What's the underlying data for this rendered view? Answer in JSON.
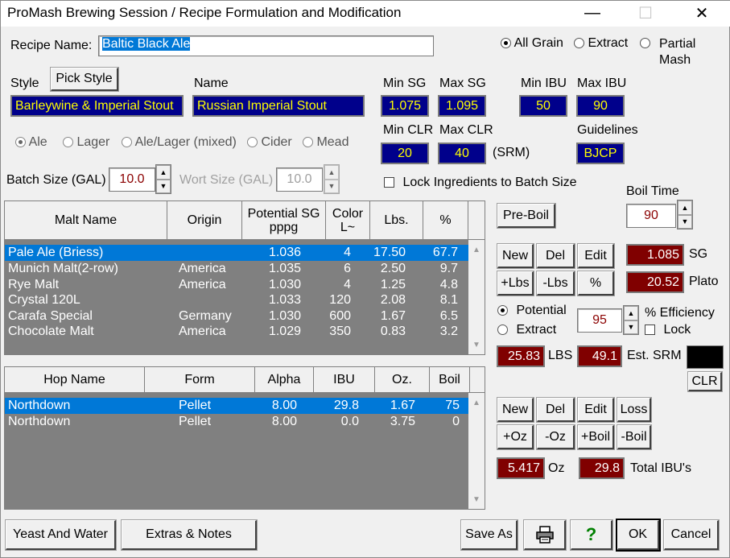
{
  "window": {
    "title": "ProMash Brewing Session / Recipe Formulation and Modification"
  },
  "recipe": {
    "name_label": "Recipe Name:",
    "name": "Baltic Black Ale"
  },
  "recipe_type": {
    "options": [
      "All Grain",
      "Extract",
      "Partial Mash"
    ],
    "selected": "All Grain"
  },
  "style": {
    "label": "Style",
    "pick_label": "Pick Style",
    "category": "Barleywine & Imperial Stout",
    "name_label": "Name",
    "name": "Russian Imperial Stout"
  },
  "guidelines_panel": {
    "min_sg_label": "Min SG",
    "min_sg": "1.075",
    "max_sg_label": "Max SG",
    "max_sg": "1.095",
    "min_ibu_label": "Min IBU",
    "min_ibu": "50",
    "max_ibu_label": "Max IBU",
    "max_ibu": "90",
    "min_clr_label": "Min CLR",
    "min_clr": "20",
    "max_clr_label": "Max CLR",
    "max_clr": "40",
    "srm_label": "(SRM)",
    "guidelines_label": "Guidelines",
    "guidelines": "BJCP"
  },
  "yeast_type": {
    "options": [
      "Ale",
      "Lager",
      "Ale/Lager (mixed)",
      "Cider",
      "Mead"
    ],
    "selected": "Ale"
  },
  "batch": {
    "batch_label": "Batch Size (GAL)",
    "batch_value": "10.0",
    "wort_label": "Wort Size (GAL)",
    "wort_value": "10.0",
    "lock_label": "Lock Ingredients to Batch Size"
  },
  "boil": {
    "label": "Boil Time",
    "value": "90",
    "preboil_label": "Pre-Boil"
  },
  "malt_table": {
    "headers": [
      "Malt Name",
      "Origin",
      "Potential SG pppg",
      "Color L~",
      "Lbs.",
      "%"
    ],
    "rows": [
      {
        "name": "Pale Ale (Briess)",
        "origin": "",
        "sg": "1.036",
        "color": "4",
        "lbs": "17.50",
        "pct": "67.7"
      },
      {
        "name": "Munich Malt(2-row)",
        "origin": "America",
        "sg": "1.035",
        "color": "6",
        "lbs": "2.50",
        "pct": "9.7"
      },
      {
        "name": "Rye Malt",
        "origin": "America",
        "sg": "1.030",
        "color": "4",
        "lbs": "1.25",
        "pct": "4.8"
      },
      {
        "name": "Crystal 120L",
        "origin": "",
        "sg": "1.033",
        "color": "120",
        "lbs": "2.08",
        "pct": "8.1"
      },
      {
        "name": "Carafa Special",
        "origin": "Germany",
        "sg": "1.030",
        "color": "600",
        "lbs": "1.67",
        "pct": "6.5"
      },
      {
        "name": "Chocolate Malt",
        "origin": "America",
        "sg": "1.029",
        "color": "350",
        "lbs": "0.83",
        "pct": "3.2"
      }
    ]
  },
  "malt_controls": {
    "new": "New",
    "del": "Del",
    "edit": "Edit",
    "plus_lbs": "+Lbs",
    "minus_lbs": "-Lbs",
    "pct": "%",
    "sg_value": "1.085",
    "sg_label": "SG",
    "plato_value": "20.52",
    "plato_label": "Plato",
    "potential_label": "Potential",
    "extract_label": "Extract",
    "efficiency_value": "95",
    "efficiency_label": "% Efficiency",
    "lock_label": "Lock",
    "lbs_value": "25.83",
    "lbs_label": "LBS",
    "srm_value": "49.1",
    "srm_label": "Est. SRM",
    "clr_label": "CLR",
    "srm_color": "#000000"
  },
  "hop_table": {
    "headers": [
      "Hop Name",
      "Form",
      "Alpha",
      "IBU",
      "Oz.",
      "Boil"
    ],
    "rows": [
      {
        "name": "Northdown",
        "form": "Pellet",
        "alpha": "8.00",
        "ibu": "29.8",
        "oz": "1.67",
        "boil": "75"
      },
      {
        "name": "Northdown",
        "form": "Pellet",
        "alpha": "8.00",
        "ibu": "0.0",
        "oz": "3.75",
        "boil": "0"
      }
    ]
  },
  "hop_controls": {
    "new": "New",
    "del": "Del",
    "edit": "Edit",
    "loss": "Loss",
    "plus_oz": "+Oz",
    "minus_oz": "-Oz",
    "plus_boil": "+Boil",
    "minus_boil": "-Boil",
    "oz_value": "5.417",
    "oz_label": "Oz",
    "ibu_value": "29.8",
    "ibu_label": "Total IBU's"
  },
  "footer": {
    "yeast_water": "Yeast And Water",
    "extras_notes": "Extras & Notes",
    "save_as": "Save As",
    "ok": "OK",
    "cancel": "Cancel"
  },
  "colors": {
    "selection": "#0078d7",
    "guideline_bg": "#00008b",
    "guideline_text": "#ffff00",
    "stat_bg": "#800000",
    "grid_bg": "#808080"
  }
}
